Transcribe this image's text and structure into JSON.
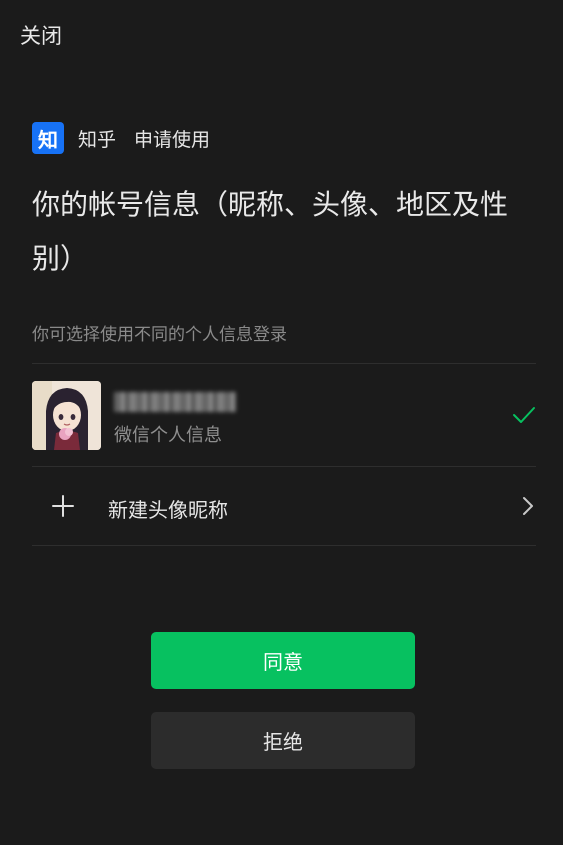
{
  "header": {
    "close_label": "关闭"
  },
  "app": {
    "logo_text": "知",
    "name": "知乎",
    "action": "申请使用",
    "brand_color": "#1772f6"
  },
  "request": {
    "headline": "你的帐号信息（昵称、头像、地区及性别）",
    "hint": "你可选择使用不同的个人信息登录"
  },
  "profile_option": {
    "name_obscured": "",
    "subtitle": "微信个人信息",
    "selected": true,
    "check_color": "#07c160",
    "avatar_icon": "anime-avatar"
  },
  "new_option": {
    "icon": "plus-icon",
    "label": "新建头像昵称",
    "chevron": "chevron-right-icon"
  },
  "buttons": {
    "agree_label": "同意",
    "agree_color": "#07c160",
    "reject_label": "拒绝"
  }
}
